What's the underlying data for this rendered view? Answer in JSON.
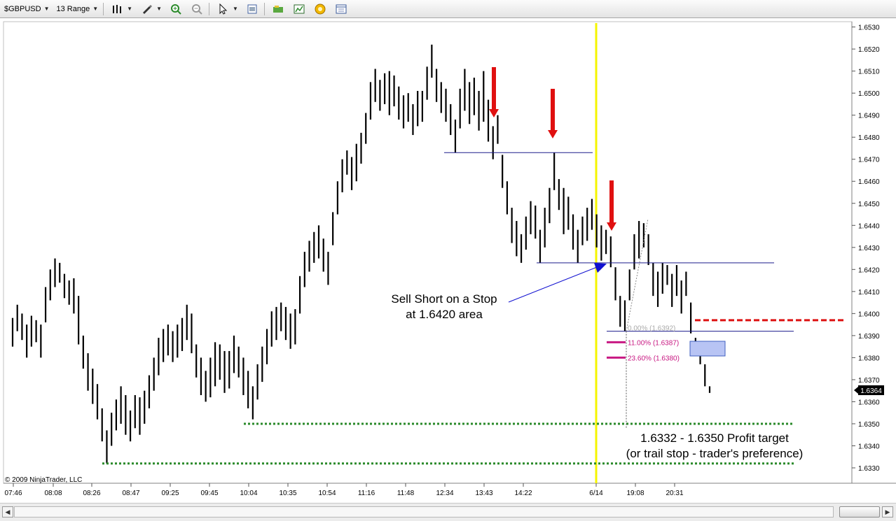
{
  "toolbar": {
    "instrument": "$GBPUSD",
    "period": "13 Range",
    "icons": [
      "bar-style-icon",
      "drawing-tool-icon",
      "zoom-in-icon",
      "zoom-out-icon",
      "pointer-icon",
      "properties-icon",
      "instrument-icon",
      "chart-trader-icon",
      "strategy-icon",
      "data-box-icon"
    ]
  },
  "chart_data": {
    "type": "ohlc",
    "y_ticks": [
      "1.6330",
      "1.6340",
      "1.6350",
      "1.6360",
      "1.6370",
      "1.6380",
      "1.6390",
      "1.6400",
      "1.6410",
      "1.6420",
      "1.6430",
      "1.6440",
      "1.6450",
      "1.6460",
      "1.6470",
      "1.6480",
      "1.6490",
      "1.6500",
      "1.6510",
      "1.6520",
      "1.6530"
    ],
    "ylim": [
      1.6325,
      1.6533
    ],
    "x_ticks": [
      "07:46",
      "08:08",
      "08:26",
      "08:47",
      "09:25",
      "09:45",
      "10:04",
      "10:35",
      "10:54",
      "11:16",
      "11:48",
      "12:34",
      "13:43",
      "14:22",
      "6/14",
      "19:08",
      "20:31"
    ],
    "last_price": "1.6364",
    "copyright": "© 2009 NinjaTrader, LLC",
    "bars_hl": [
      [
        1.6385,
        1.6398
      ],
      [
        1.6392,
        1.6404
      ],
      [
        1.6388,
        1.64
      ],
      [
        1.638,
        1.6395
      ],
      [
        1.6385,
        1.6399
      ],
      [
        1.6387,
        1.6397
      ],
      [
        1.638,
        1.6395
      ],
      [
        1.6396,
        1.6412
      ],
      [
        1.6406,
        1.642
      ],
      [
        1.6412,
        1.6425
      ],
      [
        1.6414,
        1.6423
      ],
      [
        1.6407,
        1.6418
      ],
      [
        1.6404,
        1.6415
      ],
      [
        1.64,
        1.6416
      ],
      [
        1.6386,
        1.6408
      ],
      [
        1.6375,
        1.639
      ],
      [
        1.6365,
        1.6382
      ],
      [
        1.6359,
        1.6375
      ],
      [
        1.6352,
        1.6368
      ],
      [
        1.6342,
        1.6357
      ],
      [
        1.6332,
        1.6347
      ],
      [
        1.634,
        1.6355
      ],
      [
        1.6347,
        1.6361
      ],
      [
        1.635,
        1.6367
      ],
      [
        1.6345,
        1.6363
      ],
      [
        1.6342,
        1.6356
      ],
      [
        1.6348,
        1.6363
      ],
      [
        1.6345,
        1.6362
      ],
      [
        1.635,
        1.6365
      ],
      [
        1.6357,
        1.6372
      ],
      [
        1.6365,
        1.638
      ],
      [
        1.6372,
        1.6389
      ],
      [
        1.6378,
        1.6393
      ],
      [
        1.6381,
        1.6395
      ],
      [
        1.6378,
        1.6392
      ],
      [
        1.638,
        1.6395
      ],
      [
        1.6383,
        1.6398
      ],
      [
        1.6388,
        1.6404
      ],
      [
        1.6382,
        1.64
      ],
      [
        1.6371,
        1.6386
      ],
      [
        1.6363,
        1.638
      ],
      [
        1.636,
        1.6374
      ],
      [
        1.6362,
        1.638
      ],
      [
        1.6367,
        1.6387
      ],
      [
        1.637,
        1.6386
      ],
      [
        1.6364,
        1.6383
      ],
      [
        1.6366,
        1.6383
      ],
      [
        1.6373,
        1.639
      ],
      [
        1.6371,
        1.6385
      ],
      [
        1.6363,
        1.638
      ],
      [
        1.6357,
        1.6374
      ],
      [
        1.6352,
        1.6367
      ],
      [
        1.6361,
        1.6377
      ],
      [
        1.6369,
        1.6385
      ],
      [
        1.6377,
        1.6393
      ],
      [
        1.6385,
        1.6401
      ],
      [
        1.6388,
        1.6403
      ],
      [
        1.6392,
        1.6405
      ],
      [
        1.6388,
        1.6403
      ],
      [
        1.6384,
        1.64
      ],
      [
        1.6386,
        1.6402
      ],
      [
        1.64,
        1.6417
      ],
      [
        1.6412,
        1.6428
      ],
      [
        1.6419,
        1.6433
      ],
      [
        1.6423,
        1.6437
      ],
      [
        1.6425,
        1.644
      ],
      [
        1.6419,
        1.6434
      ],
      [
        1.6413,
        1.6428
      ],
      [
        1.6431,
        1.6446
      ],
      [
        1.6445,
        1.646
      ],
      [
        1.6455,
        1.647
      ],
      [
        1.6463,
        1.6474
      ],
      [
        1.6456,
        1.6471
      ],
      [
        1.646,
        1.6477
      ],
      [
        1.6468,
        1.6482
      ],
      [
        1.6477,
        1.6491
      ],
      [
        1.6488,
        1.6505
      ],
      [
        1.6496,
        1.6511
      ],
      [
        1.6492,
        1.6506
      ],
      [
        1.6495,
        1.6509
      ],
      [
        1.649,
        1.651
      ],
      [
        1.6494,
        1.6508
      ],
      [
        1.6488,
        1.6503
      ],
      [
        1.6484,
        1.6499
      ],
      [
        1.6487,
        1.65
      ],
      [
        1.6481,
        1.6495
      ],
      [
        1.6485,
        1.6501
      ],
      [
        1.6487,
        1.6501
      ],
      [
        1.6497,
        1.6512
      ],
      [
        1.6507,
        1.6522
      ],
      [
        1.6496,
        1.6511
      ],
      [
        1.6491,
        1.6505
      ],
      [
        1.6487,
        1.6502
      ],
      [
        1.6481,
        1.6495
      ],
      [
        1.6473,
        1.6488
      ],
      [
        1.6484,
        1.6502
      ],
      [
        1.6492,
        1.6511
      ],
      [
        1.6486,
        1.6505
      ],
      [
        1.649,
        1.6507
      ],
      [
        1.6483,
        1.6501
      ],
      [
        1.6487,
        1.651
      ],
      [
        1.6478,
        1.6497
      ],
      [
        1.647,
        1.6485
      ],
      [
        1.6477,
        1.649
      ],
      [
        1.6457,
        1.6472
      ],
      [
        1.6445,
        1.646
      ],
      [
        1.6432,
        1.6448
      ],
      [
        1.6426,
        1.6442
      ],
      [
        1.6423,
        1.6436
      ],
      [
        1.6429,
        1.6444
      ],
      [
        1.6436,
        1.6451
      ],
      [
        1.6434,
        1.6449
      ],
      [
        1.6423,
        1.6438
      ],
      [
        1.643,
        1.6448
      ],
      [
        1.6441,
        1.6457
      ],
      [
        1.6456,
        1.6473
      ],
      [
        1.6447,
        1.6461
      ],
      [
        1.6436,
        1.6457
      ],
      [
        1.6438,
        1.6453
      ],
      [
        1.6429,
        1.6445
      ],
      [
        1.6423,
        1.6438
      ],
      [
        1.6431,
        1.6444
      ],
      [
        1.6433,
        1.6448
      ],
      [
        1.6438,
        1.6452
      ],
      [
        1.643,
        1.6445
      ],
      [
        1.6424,
        1.644
      ],
      [
        1.6427,
        1.6438
      ],
      [
        1.6421,
        1.6435
      ],
      [
        1.6406,
        1.6421
      ],
      [
        1.6394,
        1.6408
      ],
      [
        1.6392,
        1.6406
      ],
      [
        1.6406,
        1.642
      ],
      [
        1.642,
        1.6436
      ],
      [
        1.6425,
        1.6442
      ],
      [
        1.643,
        1.6441
      ],
      [
        1.6422,
        1.6436
      ],
      [
        1.6408,
        1.6423
      ],
      [
        1.6403,
        1.6419
      ],
      [
        1.6409,
        1.6423
      ],
      [
        1.6413,
        1.6422
      ],
      [
        1.6403,
        1.6418
      ],
      [
        1.6408,
        1.6422
      ],
      [
        1.64,
        1.6415
      ],
      [
        1.6408,
        1.6419
      ],
      [
        1.6391,
        1.6405
      ],
      [
        1.6384,
        1.6389
      ],
      [
        1.6377,
        1.6382
      ],
      [
        1.6367,
        1.6377
      ],
      [
        1.6364,
        1.6367
      ]
    ],
    "annotations": {
      "sell_label": [
        "Sell Short on a Stop",
        "at 1.6420 area"
      ],
      "target_label": [
        "1.6332 - 1.6350 Profit target",
        "(or trail stop  - trader's preference)"
      ],
      "fib_labels": [
        "0.00% (1.6392)",
        "11.00% (1.6387)",
        "23.60% (1.6380)"
      ]
    },
    "levels": {
      "resistance_1": 1.6473,
      "support_1": 1.6423,
      "stop_line": 1.6397,
      "fib_base": 1.6392,
      "target_1": 1.635,
      "target_2": 1.6332
    },
    "colors": {
      "bars": "#000000",
      "horizontal_lines": "#1c1c8c",
      "arrows": "#e01010",
      "session_line": "#f5f500",
      "target_lines": "#2a8a2a",
      "stop_line": "#dd1111",
      "fib": "#c81882",
      "entry_arrow": "#1010d0",
      "entry_box": "#b8c4f4"
    }
  }
}
